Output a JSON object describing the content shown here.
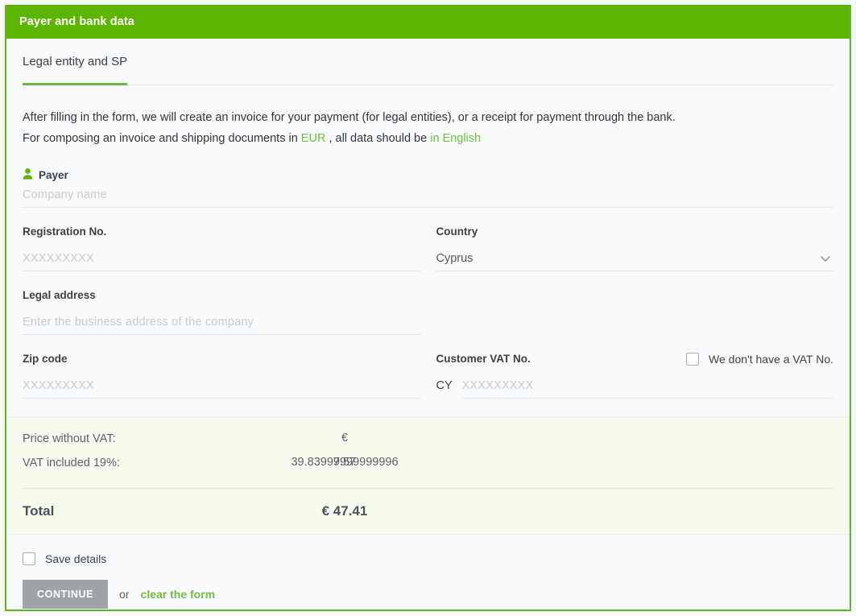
{
  "header": {
    "title": "Payer and bank data",
    "bg_color": "#5cb500"
  },
  "tabs": [
    {
      "label": "Legal entity and SP",
      "active": true
    }
  ],
  "intro": {
    "line1": "After filling in the form, we will create an invoice for your payment (for legal entities), or a receipt for payment through the bank.",
    "line2_part1": "For composing an invoice and shipping documents in",
    "currency_link": "EUR",
    "line2_part2": ", all data should be",
    "language_link": "in English",
    "link_color": "#6cbf3f"
  },
  "payer": {
    "section_label": "Payer",
    "icon": "person-icon",
    "company_name_placeholder": "Company name",
    "company_name_value": ""
  },
  "fields": {
    "registration_no": {
      "label": "Registration No.",
      "placeholder": "XXXXXXXXX",
      "value": ""
    },
    "country": {
      "label": "Country",
      "value": "Cyprus",
      "chevron": "chevron-down-icon"
    },
    "legal_address": {
      "label": "Legal address",
      "placeholder": "Enter the business address of the company",
      "value": ""
    },
    "zip_code": {
      "label": "Zip code",
      "placeholder": "XXXXXXXXX",
      "value": ""
    },
    "customer_vat": {
      "label": "Customer VAT No.",
      "prefix": "CY",
      "placeholder": "XXXXXXXXX",
      "value": "",
      "no_vat_label": "We don't have a VAT No.",
      "no_vat_checked": false
    }
  },
  "summary": {
    "price_without_vat_label": "Price without VAT:",
    "price_without_vat_value": "€",
    "vat_included_label": "VAT included 19%:",
    "vat_included_value": "39.83999999999996",
    "vat_included_overlap_value": "7.57",
    "total_label": "Total",
    "total_value": "€ 47.41",
    "bg_color": "#f7fbee"
  },
  "footer": {
    "save_details_label": "Save details",
    "save_details_checked": false,
    "continue_label": "CONTINUE",
    "or_label": "or",
    "clear_form_label": "clear the form",
    "continue_bg": "#a0a4a8",
    "clear_color": "#6cbf3f"
  }
}
